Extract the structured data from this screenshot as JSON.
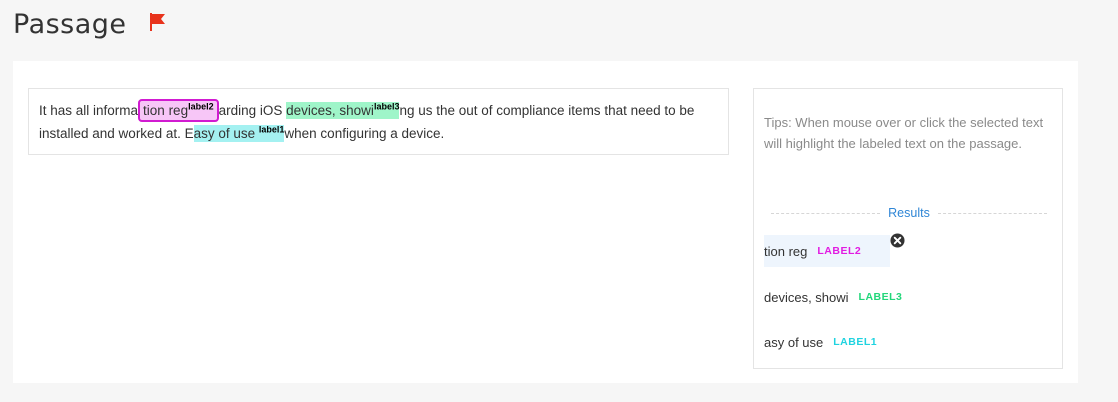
{
  "header": {
    "title": "Passage",
    "flag_color": "#e8331c"
  },
  "passage": {
    "t1": "It has all informa",
    "h1_text": "tion reg",
    "h1_label": "label2",
    "t2": "arding iOS ",
    "h2_text": "devices, showi",
    "h2_label": "label3",
    "t3": "ng us the out of compliance items that need to be installed and worked at. E",
    "h3_text": "asy of use ",
    "h3_label": "label1",
    "t4": "when configuring a device."
  },
  "side": {
    "tips": "Tips: When mouse over or click the selected text will highlight the labeled text on the passage.",
    "results_title": "Results",
    "results": [
      {
        "text": "tion reg",
        "label": "LABEL2",
        "color": "#e21be2"
      },
      {
        "text": "devices, showi",
        "label": "LABEL3",
        "color": "#22d67a"
      },
      {
        "text": "asy of use",
        "label": "LABEL1",
        "color": "#1fd3e0"
      }
    ]
  }
}
